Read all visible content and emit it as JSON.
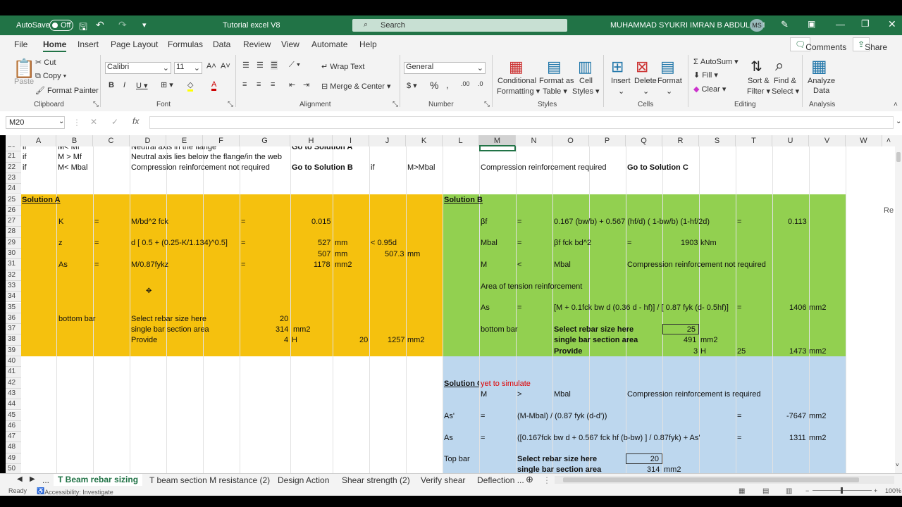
{
  "titlebar": {
    "autosave_label": "AutoSave",
    "autosave_state": "Off",
    "doc_title": "Tutorial excel V8",
    "search_placeholder": "Search",
    "user_name": "MUHAMMAD SYUKRI IMRAN B ABDULLAH",
    "user_initials": "MS"
  },
  "menu": [
    "File",
    "Home",
    "Insert",
    "Page Layout",
    "Formulas",
    "Data",
    "Review",
    "View",
    "Automate",
    "Help"
  ],
  "menu_right": {
    "comments": "Comments",
    "share": "Share"
  },
  "ribbon": {
    "clipboard": {
      "paste": "Paste",
      "cut": "Cut",
      "copy": "Copy",
      "format_painter": "Format Painter",
      "group": "Clipboard"
    },
    "font": {
      "name": "Calibri",
      "size": "11",
      "group": "Font"
    },
    "alignment": {
      "wrap": "Wrap Text",
      "merge": "Merge & Center",
      "group": "Alignment"
    },
    "number": {
      "format": "General",
      "group": "Number"
    },
    "styles": {
      "cond1": "Conditional",
      "cond2": "Formatting",
      "fmt1": "Format as",
      "fmt2": "Table",
      "cell1": "Cell",
      "cell2": "Styles",
      "group": "Styles"
    },
    "cells": {
      "insert": "Insert",
      "delete": "Delete",
      "format": "Format",
      "group": "Cells"
    },
    "editing": {
      "autosum": "AutoSum",
      "fill": "Fill",
      "clear": "Clear",
      "sort1": "Sort &",
      "sort2": "Filter",
      "find1": "Find &",
      "find2": "Select",
      "group": "Editing"
    },
    "analysis": {
      "a1": "Analyze",
      "a2": "Data",
      "group": "Analysis"
    }
  },
  "formula_bar": {
    "name_box": "M20",
    "fx": "fx",
    "value": ""
  },
  "columns": [
    "A",
    "B",
    "C",
    "D",
    "E",
    "F",
    "G",
    "H",
    "I",
    "J",
    "K",
    "L",
    "M",
    "N",
    "O",
    "P",
    "Q",
    "R",
    "S",
    "T",
    "U",
    "V",
    "W"
  ],
  "rows": [
    "20",
    "21",
    "22",
    "23",
    "24",
    "25",
    "26",
    "27",
    "28",
    "29",
    "30",
    "31",
    "32",
    "33",
    "34",
    "35",
    "36",
    "37",
    "38",
    "39",
    "40",
    "41",
    "42",
    "43",
    "44",
    "45",
    "46",
    "47",
    "48",
    "49",
    "50"
  ],
  "cells": {
    "r20": {
      "a": "if",
      "b": "M< Mf",
      "d": "Neutral axis in the flange",
      "h": "Go to Solution A"
    },
    "r21": {
      "a": "if",
      "b": "M > Mf",
      "d": "Neutral axis lies below the flange/in the web"
    },
    "r22": {
      "a": "if",
      "b": "M< Mbal",
      "d": "Compression reinforcement not required",
      "h": "Go to Solution B",
      "j": "if",
      "k": "M>Mbal",
      "m": "Compression reinforcement required",
      "q": "Go to Solution C"
    },
    "solA": {
      "title": "Solution A",
      "k": "K",
      "eq": "=",
      "k_f": "M/bd^2 fck",
      "k_v": "0.015",
      "z": "z",
      "z_f": "d [ 0.5 + (0.25-K/1.134)^0.5]",
      "z_v1": "527",
      "z_u1": "mm",
      "z_c": "< 0.95d",
      "z_v2": "507",
      "z_u2": "mm",
      "z_v3": "507.3",
      "z_u3": "mm",
      "as": "As",
      "as_f": "M/0.87fykz",
      "as_v": "1178",
      "as_u": "mm2",
      "bb": "bottom bar",
      "sel": "Select rebar size here",
      "sel_v": "20",
      "sba": "single bar section area",
      "sba_v": "314",
      "sba_u": "mm2",
      "prov": "Provide",
      "prov_n": "4",
      "prov_h": "H",
      "prov_d": "20",
      "prov_a": "1257",
      "prov_u": "mm2"
    },
    "solB": {
      "title": "Solution B",
      "bf": "βf",
      "eq": "=",
      "bf_f": "0.167 (bw/b) + 0.567 (hf/d) ( 1-bw/b) (1-hf/2d)",
      "bf_v": "0.113",
      "mbal": "Mbal",
      "mbal_f": "βf fck bd^2",
      "mbal_v": "1903",
      "mbal_u": "kNm",
      "m": "M",
      "lt": "<",
      "m_r": "Mbal",
      "m_t": "Compression reinforcement not required",
      "area": "Area of tension reinforcement",
      "as": "As",
      "as_f": "[M + 0.1fck bw d (0.36 d - hf)] / [ 0.87 fyk (d- 0.5hf)]",
      "as_v": "1406",
      "as_u": "mm2",
      "bb": "bottom bar",
      "sel": "Select rebar size here",
      "sel_v": "25",
      "sba": "single bar section area",
      "sba_v": "491",
      "sba_u": "mm2",
      "prov": "Provide",
      "prov_n": "3",
      "prov_h": "H",
      "prov_d": "25",
      "prov_a": "1473",
      "prov_u": "mm2"
    },
    "solC": {
      "title": "Solution C",
      "note": "yet to simulate",
      "m": "M",
      "gt": ">",
      "mbal": "Mbal",
      "req": "Compression reinforcement is required",
      "asp": "As'",
      "eq": "=",
      "asp_f": "(M-Mbal) / (0.87 fyk (d-d'))",
      "asp_v": "-7647",
      "asp_u": "mm2",
      "as": "As",
      "as_f": "([0.167fck bw d + 0.567 fck hf (b-bw) ] / 0.87fyk) + As'",
      "as_v": "1311",
      "as_u": "mm2",
      "tb": "Top bar",
      "sel": "Select rebar size here",
      "sel_v": "20",
      "sba": "single bar section area",
      "sba_v": "314",
      "sba_u": "mm2"
    },
    "w26": "Re"
  },
  "sheets": [
    "T Beam rebar sizing",
    "T beam section M resistance (2)",
    "Design Action",
    "Shear strength (2)",
    "Verify shear",
    "Deflection ..."
  ],
  "status": {
    "ready": "Ready",
    "access": "Accessibility: Investigate",
    "zoom": "100%"
  },
  "colors": {
    "excel_green": "#217346",
    "solA": "#f5c10e",
    "solB": "#92d050",
    "solC": "#bdd7ee",
    "red": "#e00000"
  }
}
